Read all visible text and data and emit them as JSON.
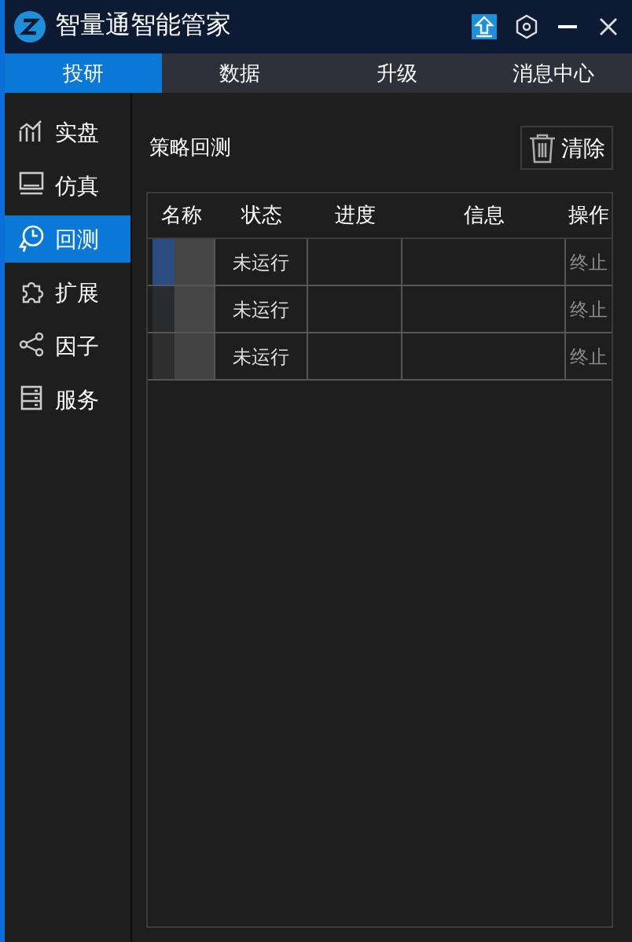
{
  "window": {
    "title": "智量通智能管家"
  },
  "tabs": [
    {
      "label": "投研",
      "selected": true
    },
    {
      "label": "数据",
      "selected": false
    },
    {
      "label": "升级",
      "selected": false
    },
    {
      "label": "消息中心",
      "selected": false
    }
  ],
  "sidebar": {
    "items": [
      {
        "label": "实盘",
        "selected": false
      },
      {
        "label": "仿真",
        "selected": false
      },
      {
        "label": "回测",
        "selected": true
      },
      {
        "label": "扩展",
        "selected": false
      },
      {
        "label": "因子",
        "selected": false
      },
      {
        "label": "服务",
        "selected": false
      }
    ]
  },
  "panel": {
    "title": "策略回测",
    "clear_button": "清除"
  },
  "table": {
    "columns": [
      "名称",
      "状态",
      "进度",
      "信息",
      "操作"
    ],
    "rows": [
      {
        "status": "未运行",
        "action": "终止",
        "action_disabled": true
      },
      {
        "status": "未运行",
        "action": "终止",
        "action_disabled": true
      },
      {
        "status": "未运行",
        "action": "终止",
        "action_disabled": true
      }
    ]
  }
}
